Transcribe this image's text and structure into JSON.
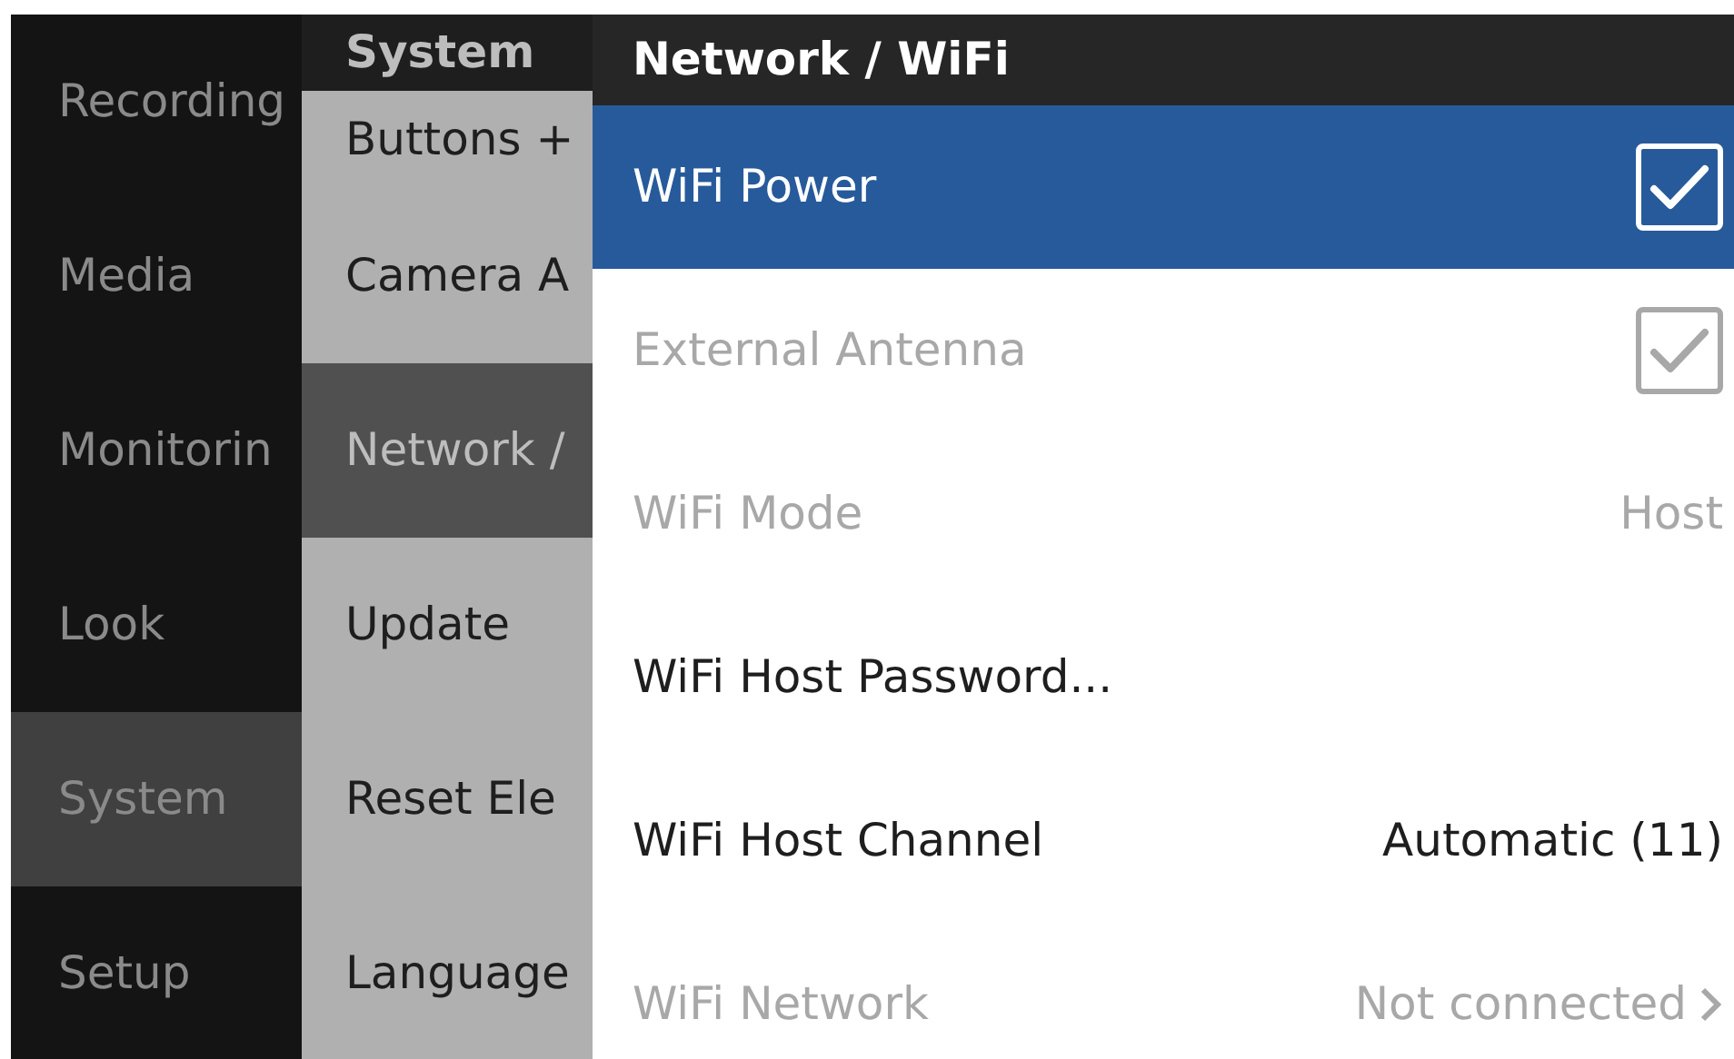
{
  "sidebar": {
    "items": [
      {
        "label": "Recording",
        "selected": false
      },
      {
        "label": "Media",
        "selected": false
      },
      {
        "label": "Monitorin",
        "selected": false
      },
      {
        "label": "Look",
        "selected": false
      },
      {
        "label": "System",
        "selected": true
      },
      {
        "label": "Setup",
        "selected": false
      }
    ]
  },
  "submenu": {
    "title": "System",
    "items": [
      {
        "label": "Buttons +",
        "selected": false
      },
      {
        "label": "Camera A",
        "selected": false
      },
      {
        "label": "Network /",
        "selected": true
      },
      {
        "label": "Update",
        "selected": false
      },
      {
        "label": "Reset Ele",
        "selected": false
      },
      {
        "label": "Language",
        "selected": false
      }
    ]
  },
  "panel": {
    "title": "Network / WiFi",
    "rows": [
      {
        "kind": "checkbox",
        "label": "WiFi Power",
        "checked": true,
        "selected": true,
        "disabled": false
      },
      {
        "kind": "checkbox",
        "label": "External Antenna",
        "checked": true,
        "selected": false,
        "disabled": true
      },
      {
        "kind": "value",
        "label": "WiFi Mode",
        "value": "Host",
        "selected": false,
        "disabled": true
      },
      {
        "kind": "action",
        "label": "WiFi Host Password...",
        "selected": false,
        "disabled": false
      },
      {
        "kind": "value",
        "label": "WiFi Host Channel",
        "value": "Automatic (11)",
        "selected": false,
        "disabled": false
      },
      {
        "kind": "link",
        "label": "WiFi Network",
        "value": "Not connected",
        "selected": false,
        "disabled": true
      }
    ]
  }
}
